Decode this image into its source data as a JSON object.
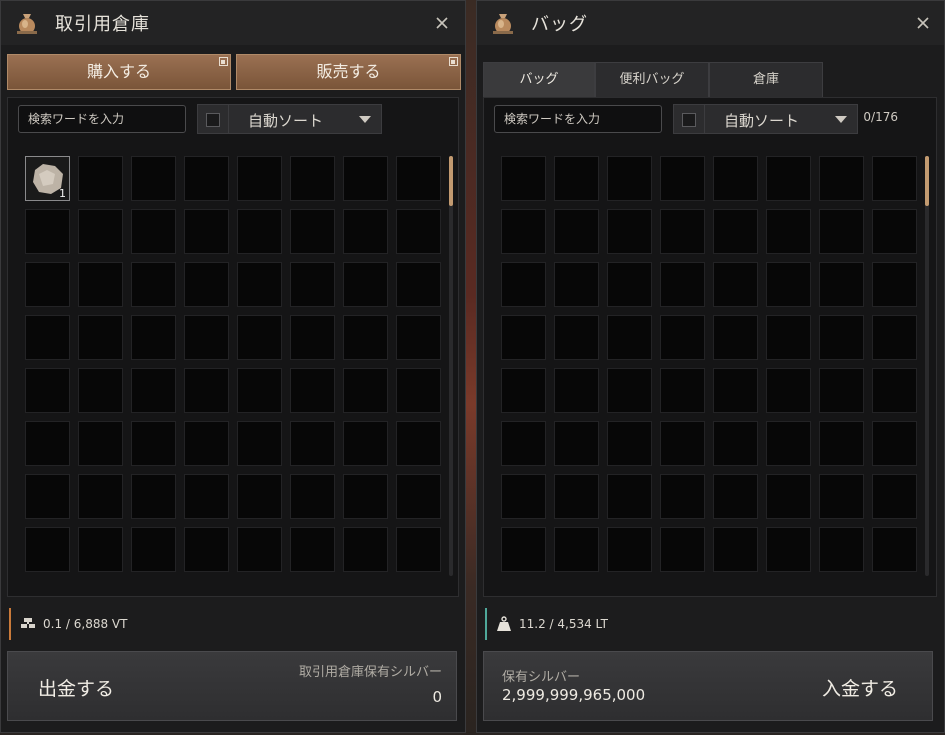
{
  "left_window": {
    "title": "取引用倉庫",
    "buy_label": "購入する",
    "sell_label": "販売する",
    "search_placeholder": "検索ワードを入力",
    "auto_sort_label": "自動ソート",
    "slot_count": 64,
    "items": [
      {
        "slot": 0,
        "icon": "stone-item-icon",
        "quantity": "1"
      }
    ],
    "weight_text": "0.1 / 6,888 VT",
    "withdraw_label": "出金する",
    "silver_caption": "取引用倉庫保有シルバー",
    "silver_value": "0",
    "accent_color": "#c97a3a"
  },
  "right_window": {
    "title": "バッグ",
    "tabs": [
      {
        "label": "バッグ",
        "active": true
      },
      {
        "label": "便利バッグ",
        "active": false
      },
      {
        "label": "倉庫",
        "active": false
      }
    ],
    "search_placeholder": "検索ワードを入力",
    "auto_sort_label": "自動ソート",
    "slot_count_text": "0/176",
    "slot_count": 64,
    "weight_text": "11.2 / 4,534 LT",
    "silver_caption": "保有シルバー",
    "silver_value": "2,999,999,965,000",
    "deposit_label": "入金する",
    "accent_color": "#4fa89a"
  },
  "icons": {
    "window_icon": "money-bag-icon",
    "close": "close-icon",
    "warehouse_weight": "warehouse-icon",
    "bag_weight": "weight-icon"
  },
  "colors": {
    "button_brown": "#8a6045",
    "scroll_thumb": "#c29a70"
  }
}
